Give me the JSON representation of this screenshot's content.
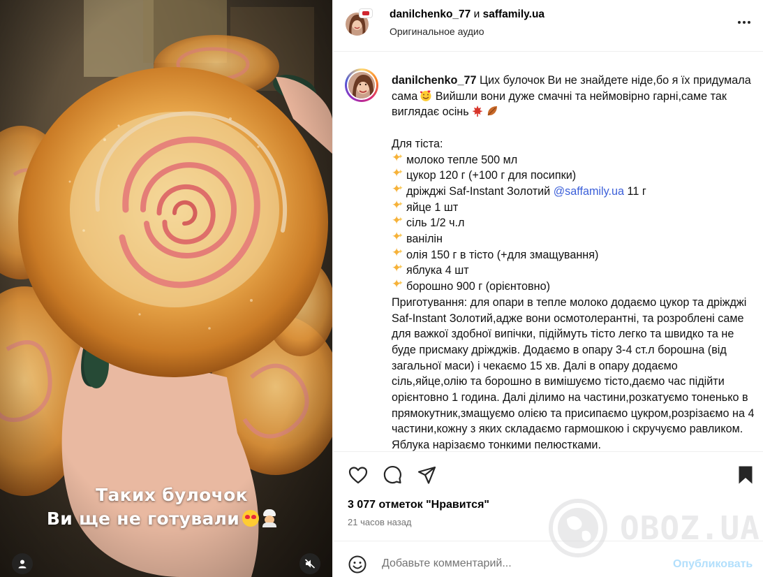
{
  "media": {
    "overlay_line1": "Таких булочок",
    "overlay_line2": "Ви ще не готували",
    "icons": [
      "user-icon",
      "muted-speaker-icon"
    ]
  },
  "header": {
    "user1": "danilchenko_77",
    "joiner": "и",
    "user2": "saffamily.ua",
    "audio": "Оригинальное аудио"
  },
  "caption": {
    "username": "danilchenko_77",
    "intro1": "Цих булочок Ви не знайдете ніде,бо я їх придумала сама",
    "intro2": "Вийшли вони дуже смачні та неймовірно гарні,саме так виглядає осінь",
    "dough_title": "Для тіста:",
    "ingredients": [
      "молоко тепле 500 мл",
      "цукор 120 г (+100 г для посипки)",
      "дріжджі Saf-Instant Золотий",
      "яйце 1 шт",
      "сіль 1/2 ч.л",
      "ванілін",
      "олія 150 г в тісто (+для змащування)",
      "яблука 4 шт",
      "борошно 900 г (орієнтовно)"
    ],
    "mention": "@saffamily.ua",
    "yeast_amount": "11 г",
    "prep": "Приготування: для опари в тепле молоко додаємо цукор та дріжджі Saf-Instant Золотий,адже вони осмотолерантні, та розроблені саме для важкої здобної випічки, підіймуть тісто легко та швидко та не буде присмаку дріжджів. Додаємо в опару 3-4 ст.л борошна (від загальної маси) і чекаємо 15 хв. Далі в опару додаємо сіль,яйце,олію та борошно в вимішуємо тісто,даємо час підійти орієнтовно 1 година. Далі ділимо на частини,розкатуємо тоненько в прямокутник,змащуємо олією та присипаємо цукром,розрізаємо на 4 частини,кожну з яких складаємо гармошкою і скручуємо равликом. Яблука нарізаємо тонкими пелюстками."
  },
  "actions": {
    "likes": "3 077 отметок \"Нравится\"",
    "time": "21 часов назад"
  },
  "comment": {
    "placeholder": "Добавьте комментарий...",
    "publish": "Опубликовать"
  },
  "watermark": "OBOZ.UA",
  "colors": {
    "link": "#3b5fd9",
    "publish_disabled": "#b2dffc",
    "secondary_text": "#737373"
  }
}
